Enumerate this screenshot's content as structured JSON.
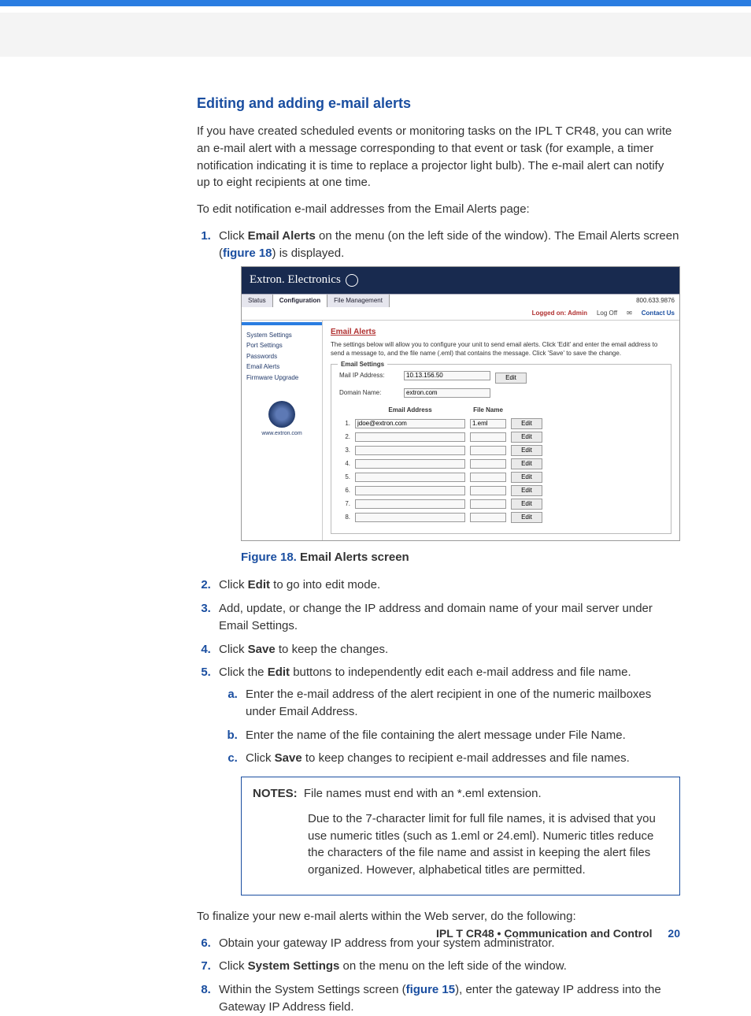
{
  "heading": "Editing and adding e-mail alerts",
  "intro_p1": "If you have created scheduled events or monitoring tasks on the IPL T CR48, you can write an e-mail alert with a message corresponding to that event or task (for example, a timer notification indicating it is time to replace a projector light bulb). The e-mail alert can notify up to eight recipients at one time.",
  "intro_p2": "To edit notification e-mail addresses from the Email Alerts page:",
  "step1_pre": "Click ",
  "step1_bold": "Email Alerts",
  "step1_post_a": " on the menu (on the left side of the window). The Email Alerts screen (",
  "step1_fig": "figure 18",
  "step1_post_b": ") is displayed.",
  "figcap_label": "Figure 18.",
  "figcap_text": " Email Alerts screen",
  "step2_pre": "Click ",
  "step2_bold": "Edit",
  "step2_post": " to go into edit mode.",
  "step3": "Add, update, or change the IP address and domain name of your mail server under Email Settings.",
  "step4_pre": "Click ",
  "step4_bold": "Save",
  "step4_post": " to keep the changes.",
  "step5_pre": "Click the ",
  "step5_bold": "Edit",
  "step5_post": " buttons to independently edit each e-mail address and file name.",
  "step5a": "Enter the e-mail address of the alert recipient in one of the numeric mailboxes under Email Address.",
  "step5b": "Enter the name of the file containing the alert message under File Name.",
  "step5c_pre": "Click ",
  "step5c_bold": "Save",
  "step5c_post": " to keep changes to recipient e-mail addresses and file names.",
  "notes_label": "NOTES:",
  "notes1": "File names must end with an *.eml extension.",
  "notes2": "Due to the 7-character limit for full file names, it is advised that you use numeric titles (such as 1.eml or 24.eml). Numeric titles reduce the characters of the file name and assist in keeping the alert files organized. However, alphabetical titles are permitted.",
  "finalize_p": "To finalize your new e-mail alerts within the Web server, do the following:",
  "step6": "Obtain your gateway IP address from your system administrator.",
  "step7_pre": "Click ",
  "step7_bold": "System Settings",
  "step7_post": " on the menu on the left side of the window.",
  "step8_pre": "Within the System Settings screen (",
  "step8_fig": "figure 15",
  "step8_post": "), enter the gateway IP address into the Gateway IP Address field.",
  "footer_text": "IPL T CR48 • Communication and Control",
  "footer_page": "20",
  "ss": {
    "brand_text": "Extron. Electronics",
    "tabs": {
      "status": "Status",
      "config": "Configuration",
      "filemgmt": "File Management"
    },
    "phone": "800.633.9876",
    "logged": "Logged on: Admin",
    "logoff": "Log Off",
    "contact": "Contact Us",
    "sidebar": {
      "system_settings": "System Settings",
      "port_settings": "Port Settings",
      "passwords": "Passwords",
      "email_alerts": "Email Alerts",
      "firmware": "Firmware Upgrade",
      "url": "www.extron.com"
    },
    "title": "Email Alerts",
    "desc": "The settings below will allow you to configure your unit to send email alerts. Click 'Edit' and enter the email address to send a message to, and the file name (.eml) that contains the message. Click 'Save' to save the change.",
    "fs_title": "Email Settings",
    "mail_ip_label": "Mail IP Address:",
    "mail_ip_value": "10.13.156.50",
    "domain_label": "Domain Name:",
    "domain_value": "extron.com",
    "editbtn": "Edit",
    "col_email": "Email Address",
    "col_file": "File Name",
    "rows": [
      {
        "n": "1.",
        "email": "jdoe@extron.com",
        "file": "1.eml"
      },
      {
        "n": "2.",
        "email": "",
        "file": ""
      },
      {
        "n": "3.",
        "email": "",
        "file": ""
      },
      {
        "n": "4.",
        "email": "",
        "file": ""
      },
      {
        "n": "5.",
        "email": "",
        "file": ""
      },
      {
        "n": "6.",
        "email": "",
        "file": ""
      },
      {
        "n": "7.",
        "email": "",
        "file": ""
      },
      {
        "n": "8.",
        "email": "",
        "file": ""
      }
    ]
  }
}
